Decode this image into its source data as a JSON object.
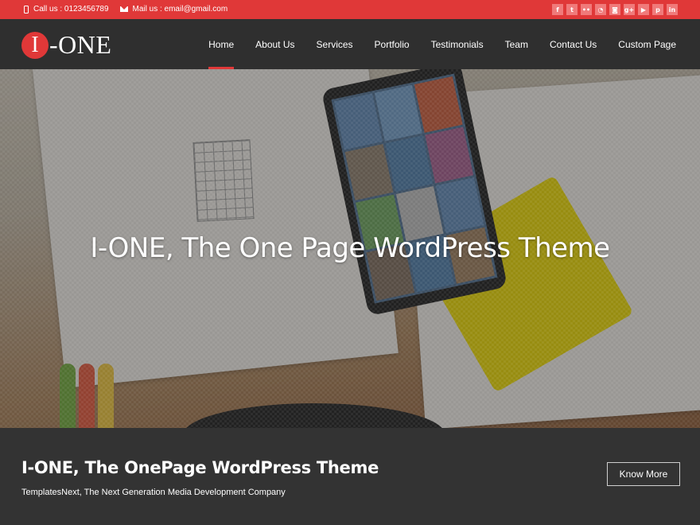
{
  "topbar": {
    "call_label": "Call us : 0123456789",
    "mail_label": "Mail us : email@gmail.com",
    "social": [
      {
        "name": "facebook-icon",
        "glyph": "f"
      },
      {
        "name": "twitter-icon",
        "glyph": "t"
      },
      {
        "name": "flickr-icon",
        "glyph": "••"
      },
      {
        "name": "rss-icon",
        "glyph": "◔"
      },
      {
        "name": "instagram-icon",
        "glyph": "◙"
      },
      {
        "name": "google-plus-icon",
        "glyph": "g+"
      },
      {
        "name": "youtube-icon",
        "glyph": "▶"
      },
      {
        "name": "pinterest-icon",
        "glyph": "p"
      },
      {
        "name": "linkedin-icon",
        "glyph": "in"
      }
    ]
  },
  "header": {
    "logo_letter": "I",
    "logo_rest": "-ONE",
    "nav": [
      {
        "label": "Home",
        "active": true
      },
      {
        "label": "About Us",
        "active": false
      },
      {
        "label": "Services",
        "active": false
      },
      {
        "label": "Portfolio",
        "active": false
      },
      {
        "label": "Testimonials",
        "active": false
      },
      {
        "label": "Team",
        "active": false
      },
      {
        "label": "Contact Us",
        "active": false
      },
      {
        "label": "Custom Page",
        "active": false
      }
    ]
  },
  "hero": {
    "headline": "I-ONE, The One Page WordPress Theme"
  },
  "band": {
    "title": "I-ONE, The OnePage WordPress Theme",
    "subtitle": "TemplatesNext, The Next Generation Media Development Company",
    "button_label": "Know More"
  },
  "colors": {
    "accent": "#e03838",
    "dark": "#2f2f2f",
    "band": "#333333"
  }
}
